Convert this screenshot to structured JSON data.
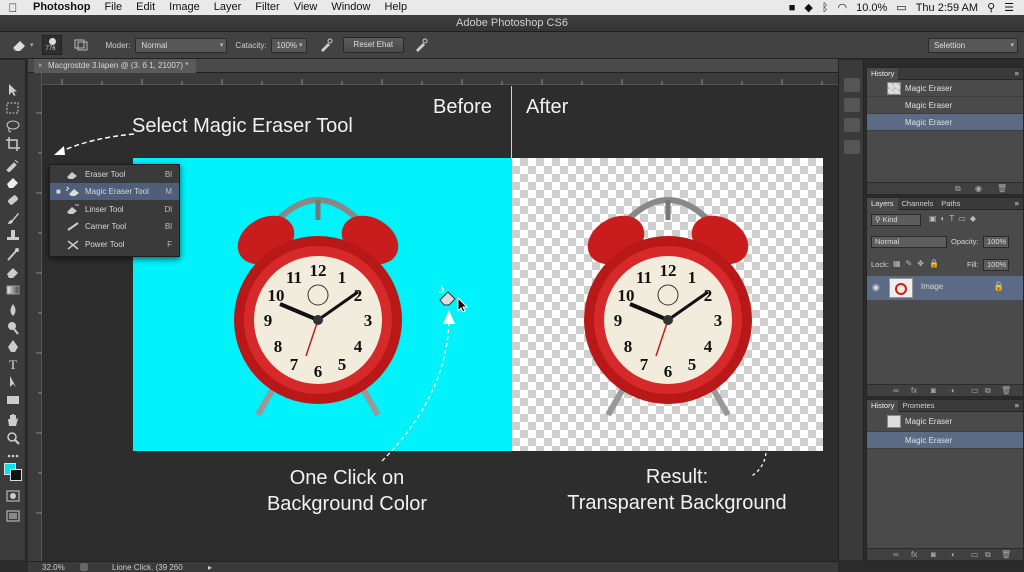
{
  "menubar": {
    "app": "Photoshop",
    "items": [
      "File",
      "Edit",
      "Image",
      "Layer",
      "Filter",
      "View",
      "Window",
      "Help"
    ],
    "battery": "10.0%",
    "clock": "Thu 2:59 AM"
  },
  "window": {
    "title": "Adobe Photoshop CS6"
  },
  "options": {
    "brush_size": "776",
    "mode_label": "Moder:",
    "mode_value": "Normal",
    "capacity_label": "Catacity:",
    "capacity_value": "100%",
    "reset_button": "Reset Ehat",
    "workspace": "Selettion"
  },
  "document": {
    "tab": "Macgrostde 3.lapen @ (3. б 1, 21007) *",
    "zoom": "32.0%",
    "status": "Lione Click. (39 260"
  },
  "canvas": {
    "label_select": "Select Magic Eraser Tool",
    "label_before": "Before",
    "label_after": "After",
    "label_click_1": "One Click on",
    "label_click_2": "Background Color",
    "label_result_1": "Result:",
    "label_result_2": "Transparent Background",
    "before_bg_color": "#00f2fa"
  },
  "flyout": {
    "items": [
      {
        "label": "Eraser Tool",
        "shortcut": "Bl"
      },
      {
        "label": "Magic Eraser Tool",
        "shortcut": "M"
      },
      {
        "label": "Linser Tool",
        "shortcut": "Dl"
      },
      {
        "label": "Carner Tool",
        "shortcut": "Bl"
      },
      {
        "label": "Power Tool",
        "shortcut": "F"
      }
    ],
    "active_index": 1
  },
  "history_panel": {
    "tab": "History",
    "items": [
      "Magic Eraser",
      "Magic Eraser",
      "Magic Eraser"
    ],
    "selected_index": 2
  },
  "layers_panel": {
    "tabs": [
      "Layers",
      "Channels",
      "Paths"
    ],
    "kind_label": "Kind",
    "blend_mode": "Normal",
    "opacity_label": "Opacity:",
    "opacity_value": "100%",
    "lock_label": "Lock:",
    "fill_label": "Fill:",
    "fill_value": "100%",
    "layer_name": "Image"
  },
  "history_panel_2": {
    "tabs": [
      "History",
      "Prometes"
    ],
    "items": [
      "Magic Eraser",
      "Magic Eraser"
    ],
    "selected_index": 1
  },
  "colors": {
    "accent_selection": "#5b6b85",
    "clock_red": "#c91d1d",
    "foreground": "#00e5ef"
  }
}
